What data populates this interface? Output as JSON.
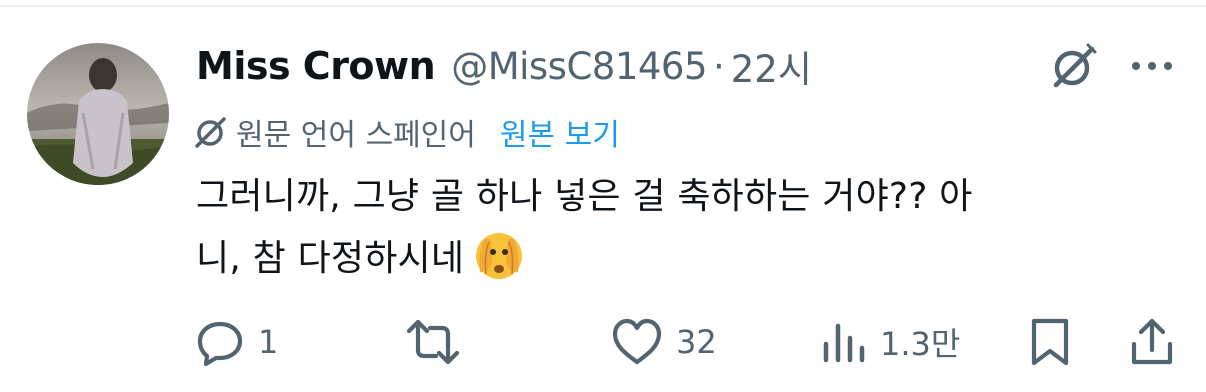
{
  "tweet": {
    "display_name": "Miss Crown",
    "handle": "@MissC81465",
    "separator": "·",
    "time": "22시",
    "translation_note": "원문 언어 스페인어",
    "show_original_label": "원본 보기",
    "text_line1": "그러니까, 그냥 골 하나 넣은 걸 축하하는 거야?? 아",
    "text_line2": "니, 참 다정하시네"
  },
  "actions": {
    "reply_count": "1",
    "retweet_count": "",
    "like_count": "32",
    "views_count": "1.3만"
  },
  "icons": {
    "grok": "grok-icon",
    "more": "more-icon",
    "translate": "translate-icon",
    "emoji": "face-with-hands-over-eyes-emoji",
    "reply": "reply-icon",
    "retweet": "retweet-icon",
    "like": "heart-icon",
    "views": "views-icon",
    "bookmark": "bookmark-icon",
    "share": "share-icon"
  },
  "colors": {
    "text_primary": "#0f1419",
    "text_secondary": "#536471",
    "link": "#1d9bf0",
    "divider": "#eff3f4"
  }
}
